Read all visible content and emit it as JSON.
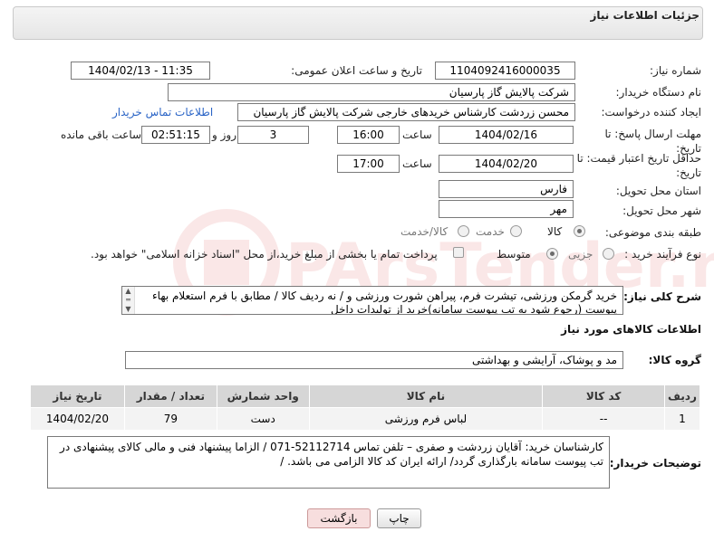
{
  "header": {
    "title": "جزئیات اطلاعات نیاز"
  },
  "labels": {
    "need_number": "شماره نیاز:",
    "announce_datetime": "تاریخ و ساعت اعلان عمومی:",
    "buyer_org": "نام دستگاه خریدار:",
    "requester": "ایجاد کننده درخواست:",
    "buyer_contact": "اطلاعات تماس خریدار",
    "deadline": "مهلت ارسال پاسخ: تا تاریخ:",
    "time": "ساعت",
    "days_and": "روز و",
    "remaining": "ساعت باقی مانده",
    "validity": "حداقل تاریخ اعتبار قیمت: تا تاریخ:",
    "province": "استان محل تحویل:",
    "city": "شهر محل تحویل:",
    "category": "طبقه بندی موضوعی:",
    "process": "نوع فرآیند خرید :",
    "general_desc": "شرح کلی نیاز:",
    "goods_info": "اطلاعات کالاهای مورد نیاز",
    "goods_group": "گروه کالا:",
    "buyer_notes": "توضیحات خریدار:"
  },
  "values": {
    "need_number": "1104092416000035",
    "announce_datetime": "1404/02/13 - 11:35",
    "buyer_org": "شرکت پالایش گاز پارسیان",
    "requester": "محسن زردشت کارشناس خریدهای خارجی شرکت پالایش گاز پارسیان",
    "deadline_date": "1404/02/16",
    "deadline_time": "16:00",
    "days": "3",
    "remaining_time": "02:51:15",
    "validity_date": "1404/02/20",
    "validity_time": "17:00",
    "province": "فارس",
    "city": "مهر",
    "general_desc": "خرید گرمکن ورزشی، تیشرت فرم، پیراهن شورت ورزشی و / نه ردیف کالا / مطابق با فرم استعلام بهاء پیوست (رجوع شود به تب پیوست سامانه)خرید از تولیدات داخل",
    "goods_group": "مد و پوشاک، آرایشی و بهداشتی",
    "buyer_notes": "کارشناسان خرید: آقایان زردشت و صفری – تلفن تماس 52112714-071 / الزاما پیشنهاد فنی و مالی کالای پیشنهادی در تب پیوست سامانه بارگذاری گردد/ ارائه ایران کد کالا الزامی می باشد. /"
  },
  "category_options": [
    {
      "label": "کالا",
      "selected": true
    },
    {
      "label": "خدمت",
      "selected": false
    },
    {
      "label": "کالا/خدمت",
      "selected": false
    }
  ],
  "process_options": [
    {
      "label": "جزیی",
      "selected": false
    },
    {
      "label": "متوسط",
      "selected": true
    }
  ],
  "process_note": "پرداخت تمام یا بخشی از مبلغ خرید،از محل \"اسناد خزانه اسلامی\" خواهد بود.",
  "table": {
    "headers": [
      "ردیف",
      "کد کالا",
      "نام کالا",
      "واحد شمارش",
      "تعداد / مقدار",
      "تاریخ نیاز"
    ],
    "rows": [
      [
        "1",
        "--",
        "لباس فرم ورزشی",
        "دست",
        "79",
        "1404/02/20"
      ]
    ]
  },
  "buttons": {
    "print": "چاپ",
    "back": "بازگشت"
  },
  "watermark": "PArsTender.net"
}
